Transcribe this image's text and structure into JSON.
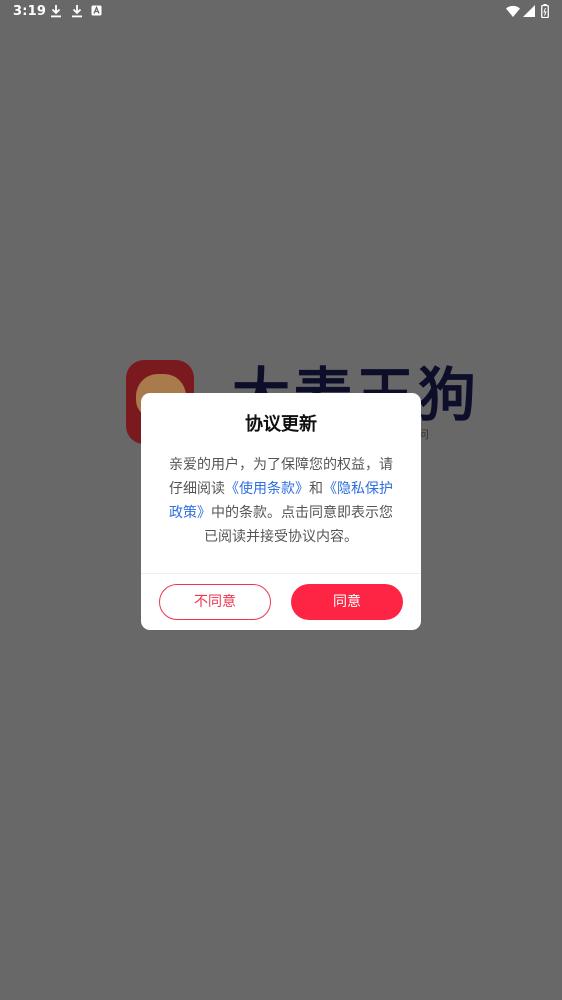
{
  "status_bar": {
    "time": "3:19",
    "left_icons": [
      "download-icon",
      "download-icon",
      "a-icon"
    ],
    "right_icons": [
      "wifi-icon",
      "signal-icon",
      "battery-icon"
    ]
  },
  "splash": {
    "logo_text": "大麦王狗",
    "logo_subtext": "问"
  },
  "dialog": {
    "title": "协议更新",
    "body_prefix": "亲爱的用户，为了保障您的权益，请仔细阅读",
    "terms_link": "《使用条款》",
    "and_text": "和",
    "privacy_link": "《隐私保护政策》",
    "body_suffix": "中的条款。点击同意即表示您已阅读并接受协议内容。",
    "disagree_label": "不同意",
    "agree_label": "同意"
  },
  "colors": {
    "overlay": "#686868",
    "accent": "#fe2443",
    "link": "#2f6fe0"
  }
}
